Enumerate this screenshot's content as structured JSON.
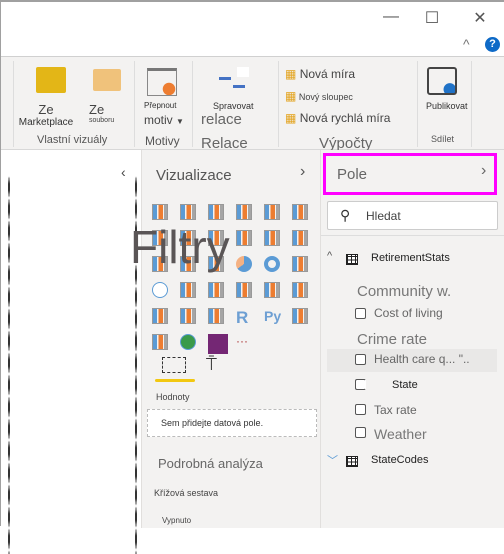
{
  "window": {
    "minimize": "—",
    "maximize": "☐",
    "close": "✕",
    "collapse_ribbon": "^",
    "help": "?"
  },
  "ribbon": {
    "custom_visuals": {
      "from_marketplace_1": "Ze",
      "from_marketplace_2": "Marketplace",
      "from_file_1": "Ze",
      "from_file_2": "souboru",
      "group": "Vlastní vizuály"
    },
    "themes": {
      "switch_1": "Přepnout",
      "switch_2": "motiv",
      "group": "Motivy"
    },
    "relations": {
      "manage_1": "Spravovat",
      "manage_2": "relace",
      "group": "Relace"
    },
    "calc": {
      "new_measure": "Nová míra",
      "new_column": "Nový sloupec",
      "new_quick_measure": "Nová rychlá míra",
      "group": "Výpočty"
    },
    "share": {
      "publish": "Publikovat",
      "group": "Sdílet"
    }
  },
  "viz": {
    "title": "Vizualizace",
    "filters_overlay": "Filtry",
    "more": "···",
    "values_label": "Hodnoty",
    "drop_hint": "Sem přidejte datová pole.",
    "drill": "Podrobná analýza",
    "cross_report": "Křížová sestava",
    "toggle_label": "Vypnuto",
    "accent": "#f2c811"
  },
  "fields": {
    "title": "Pole",
    "search_placeholder": "Hledat",
    "highlight": "#ff00ff",
    "tables": [
      {
        "name": "RetirementStats"
      },
      {
        "name": "StateCodes"
      }
    ],
    "items": [
      "Community w.",
      "Cost of living",
      "Crime rate",
      "Health care q... \"..",
      "State",
      "Tax rate",
      "Weather"
    ]
  }
}
